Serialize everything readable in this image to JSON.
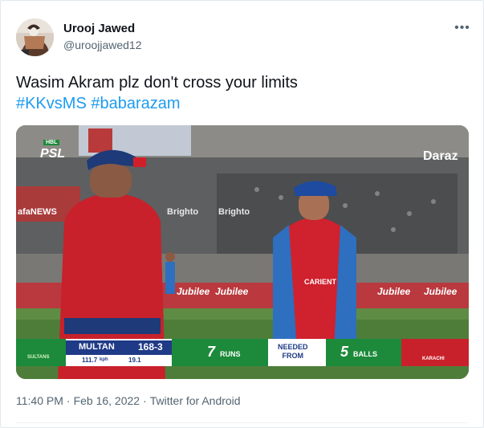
{
  "author": {
    "name": "Urooj Jawed",
    "handle": "@uroojjawed12"
  },
  "more_label": "•••",
  "tweet": {
    "line1": "Wasim Akram plz don't cross your limits",
    "hashtags": [
      "#KKvsMS",
      "#babarazam"
    ]
  },
  "media": {
    "description": "Cricket broadcast still — Wasim Akram and Babar Azam on field",
    "broadcast": {
      "hbl_label": "HBL",
      "psl_label": "PSL",
      "sponsor": "Daraz",
      "board_labels": [
        "afaNEWS",
        "Brighto",
        "Brighto",
        "Jubilee",
        "Jubilee",
        "Jubilee",
        "Jubilee"
      ],
      "team_score": {
        "team": "MULTAN",
        "score": "168-3"
      },
      "speed": {
        "value": "111.7",
        "unit": "kph",
        "over": "19.1"
      },
      "runs_needed": {
        "value": "7",
        "label": "RUNS"
      },
      "needed_from": "NEEDED\nFROM",
      "balls": {
        "value": "5",
        "label": "BALLS"
      },
      "left_team": "SULTANS",
      "right_team": "KARACHI",
      "shirt_text": "CARIENT"
    }
  },
  "footer": {
    "time": "11:40 PM",
    "date": "Feb 16, 2022",
    "source": "Twitter for Android"
  }
}
